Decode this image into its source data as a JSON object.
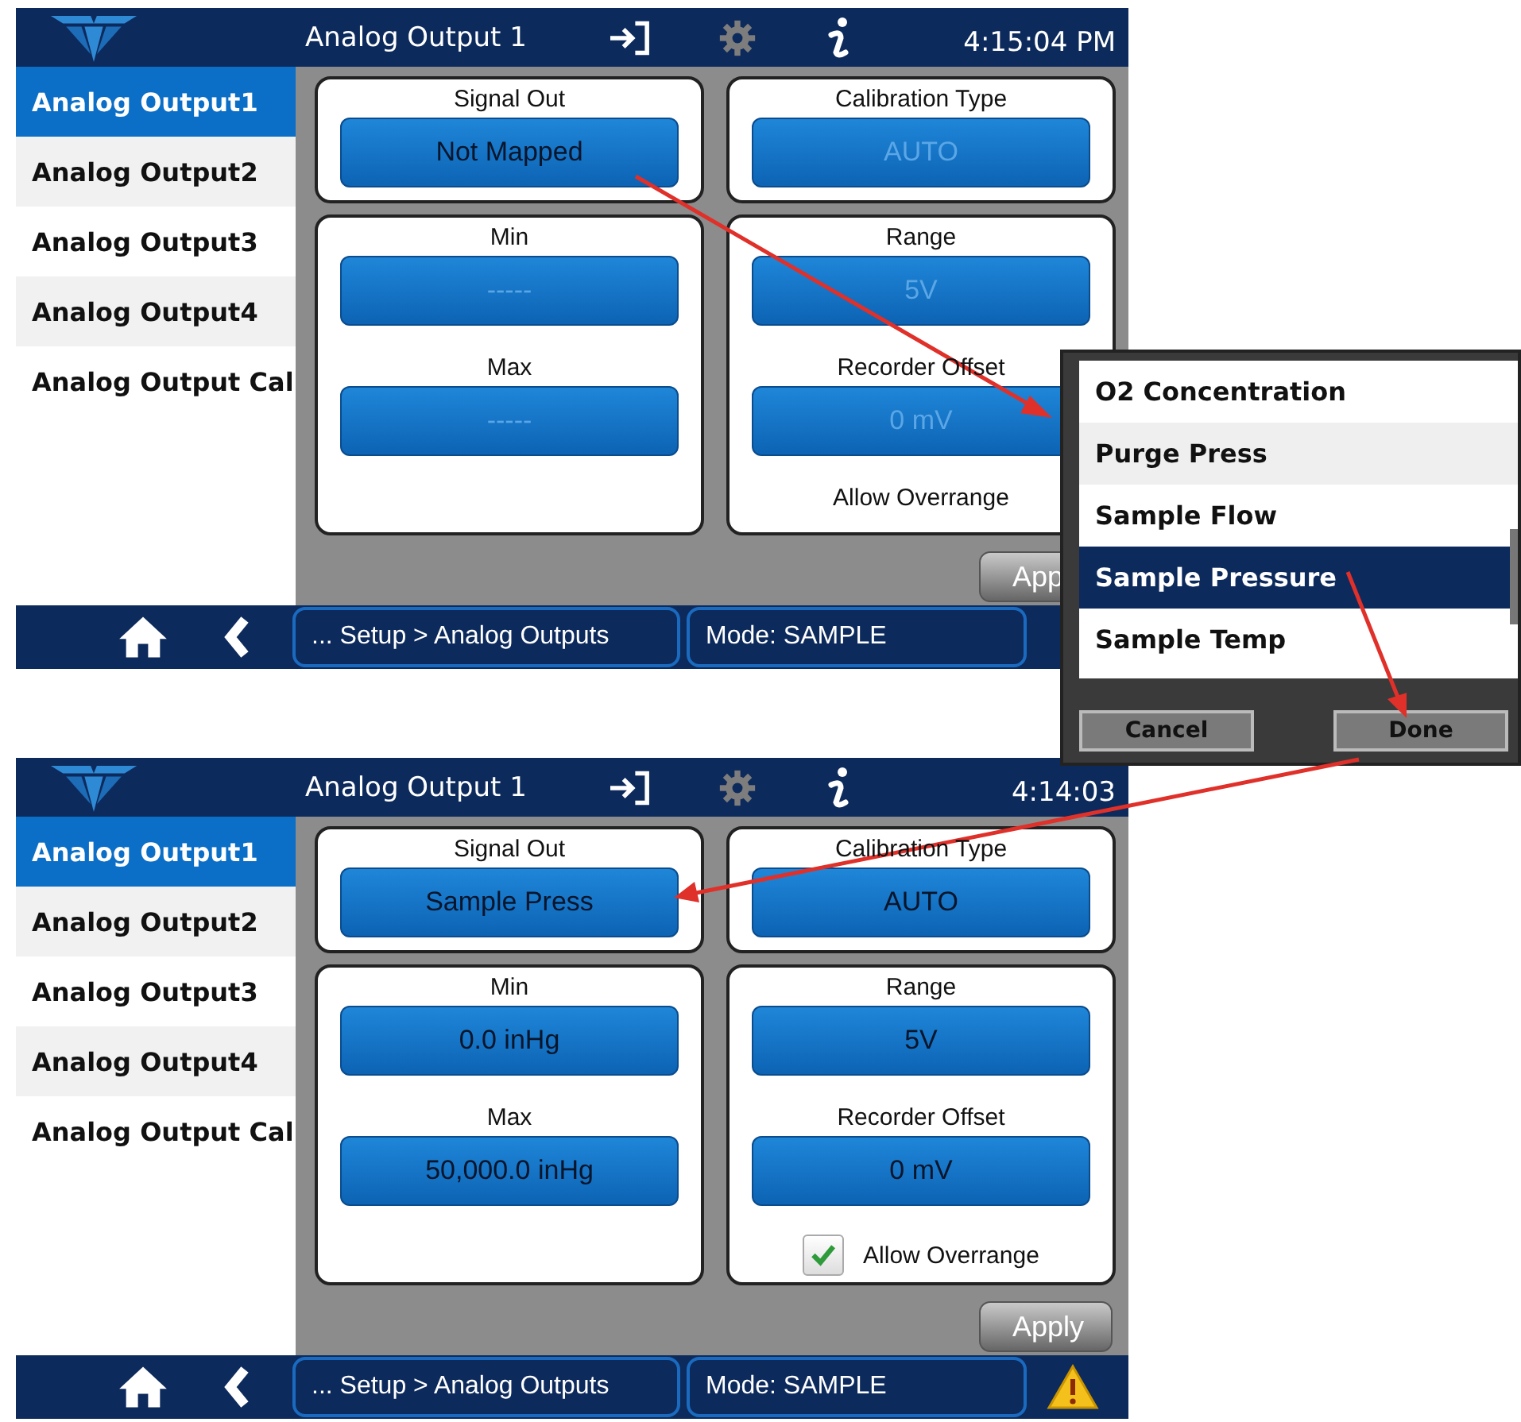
{
  "screens": [
    {
      "title": "Analog Output 1",
      "time": "4:15:04 PM",
      "sidebar": [
        {
          "label": "Analog Output1",
          "selected": true
        },
        {
          "label": "Analog Output2",
          "selected": false
        },
        {
          "label": "Analog Output3",
          "selected": false
        },
        {
          "label": "Analog Output4",
          "selected": false
        },
        {
          "label": "Analog Output Cal",
          "selected": false
        }
      ],
      "signal_out": {
        "label": "Signal Out",
        "value": "Not Mapped",
        "disabled": false
      },
      "calibration_type": {
        "label": "Calibration Type",
        "value": "AUTO",
        "disabled": true
      },
      "min": {
        "label": "Min",
        "value": "-----",
        "disabled": true
      },
      "max": {
        "label": "Max",
        "value": "-----",
        "disabled": true
      },
      "range": {
        "label": "Range",
        "value": "5V",
        "disabled": true
      },
      "recorder_offset": {
        "label": "Recorder Offset",
        "value": "0 mV",
        "disabled": true
      },
      "allow_overrange": {
        "label": "Allow Overrange"
      },
      "apply_button": "App",
      "breadcrumb": "... Setup > Analog Outputs",
      "mode": "Mode: SAMPLE"
    },
    {
      "title": "Analog Output 1",
      "time": "4:14:03",
      "sidebar": [
        {
          "label": "Analog Output1",
          "selected": true
        },
        {
          "label": "Analog Output2",
          "selected": false
        },
        {
          "label": "Analog Output3",
          "selected": false
        },
        {
          "label": "Analog Output4",
          "selected": false
        },
        {
          "label": "Analog Output Cal",
          "selected": false
        }
      ],
      "signal_out": {
        "label": "Signal Out",
        "value": "Sample Press",
        "disabled": false
      },
      "calibration_type": {
        "label": "Calibration Type",
        "value": "AUTO",
        "disabled": false
      },
      "min": {
        "label": "Min",
        "value": "0.0 inHg",
        "disabled": false
      },
      "max": {
        "label": "Max",
        "value": "50,000.0 inHg",
        "disabled": false
      },
      "range": {
        "label": "Range",
        "value": "5V",
        "disabled": false
      },
      "recorder_offset": {
        "label": "Recorder Offset",
        "value": "0 mV",
        "disabled": false
      },
      "allow_overrange": {
        "label": "Allow Overrange",
        "checked": true
      },
      "apply_button": "Apply",
      "breadcrumb": "... Setup > Analog Outputs",
      "mode": "Mode: SAMPLE",
      "warning": true
    }
  ],
  "popup": {
    "items": [
      {
        "label": "O2 Concentration",
        "selected": false
      },
      {
        "label": "Purge Press",
        "selected": false
      },
      {
        "label": "Sample Flow",
        "selected": false
      },
      {
        "label": "Sample Pressure",
        "selected": true
      },
      {
        "label": "Sample Temp",
        "selected": false
      }
    ],
    "buttons": [
      "Cancel",
      "Done"
    ]
  }
}
